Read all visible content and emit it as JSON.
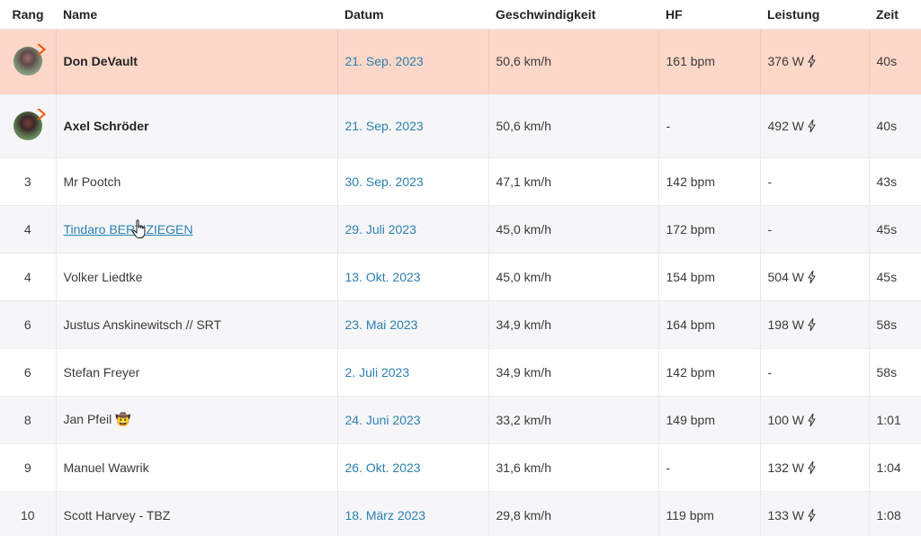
{
  "columns": {
    "rank": "Rang",
    "name": "Name",
    "date": "Datum",
    "speed": "Geschwindigkeit",
    "hf": "HF",
    "power": "Leistung",
    "time": "Zeit"
  },
  "rows": [
    {
      "rank": "",
      "name": "Don DeVault",
      "date": "21. Sep. 2023",
      "speed": "50,6 km/h",
      "hf": "161 bpm",
      "power": "376 W",
      "time": "40s"
    },
    {
      "rank": "",
      "name": "Axel Schröder",
      "date": "21. Sep. 2023",
      "speed": "50,6 km/h",
      "hf": "-",
      "power": "492 W",
      "time": "40s"
    },
    {
      "rank": "3",
      "name": "Mr Pootch",
      "date": "30. Sep. 2023",
      "speed": "47,1 km/h",
      "hf": "142 bpm",
      "power": "-",
      "time": "43s"
    },
    {
      "rank": "4",
      "name": "Tindaro BERTIZIEGEN",
      "date": "29. Juli 2023",
      "speed": "45,0 km/h",
      "hf": "172 bpm",
      "power": "-",
      "time": "45s"
    },
    {
      "rank": "4",
      "name": "Volker Liedtke",
      "date": "13. Okt. 2023",
      "speed": "45,0 km/h",
      "hf": "154 bpm",
      "power": "504 W",
      "time": "45s"
    },
    {
      "rank": "6",
      "name": "Justus Anskinewitsch // SRT",
      "date": "23. Mai 2023",
      "speed": "34,9 km/h",
      "hf": "164 bpm",
      "power": "198 W",
      "time": "58s"
    },
    {
      "rank": "6",
      "name": "Stefan Freyer",
      "date": "2. Juli 2023",
      "speed": "34,9 km/h",
      "hf": "142 bpm",
      "power": "-",
      "time": "58s"
    },
    {
      "rank": "8",
      "name": "Jan Pfeil 🤠",
      "date": "24. Juni 2023",
      "speed": "33,2 km/h",
      "hf": "149 bpm",
      "power": "100 W",
      "time": "1:01"
    },
    {
      "rank": "9",
      "name": "Manuel Wawrik",
      "date": "26. Okt. 2023",
      "speed": "31,6 km/h",
      "hf": "-",
      "power": "132 W",
      "time": "1:04"
    },
    {
      "rank": "10",
      "name": "Scott Harvey - TBZ",
      "date": "18. März 2023",
      "speed": "29,8 km/h",
      "hf": "119 bpm",
      "power": "133 W",
      "time": "1:08"
    }
  ],
  "icons": {
    "power": "lightning-bolt-icon",
    "avatar_badge": "orange-chevron-badge-icon",
    "cursor": "hand-pointer-icon"
  },
  "colors": {
    "highlight_row": "#fdd7c8",
    "alt_row": "#f6f6f8",
    "link": "#2b80b2",
    "badge": "#fc5200"
  }
}
